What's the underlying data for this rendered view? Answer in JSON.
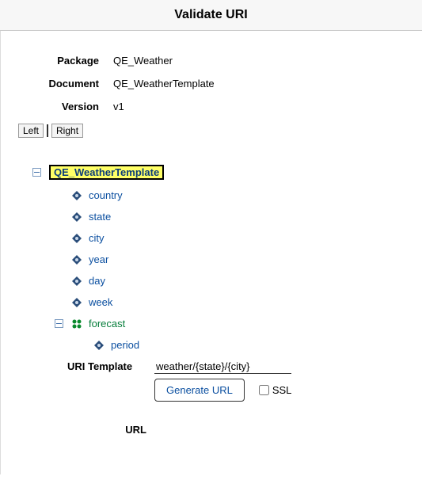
{
  "title": "Validate URI",
  "meta": {
    "package_label": "Package",
    "package_value": "QE_Weather",
    "document_label": "Document",
    "document_value": "QE_WeatherTemplate",
    "version_label": "Version",
    "version_value": "v1"
  },
  "tabs": {
    "left": "Left",
    "right": "Right"
  },
  "tree": {
    "root": "QE_WeatherTemplate",
    "children": {
      "country": "country",
      "state": "state",
      "city": "city",
      "year": "year",
      "day": "day",
      "week": "week",
      "forecast": "forecast",
      "period": "period"
    }
  },
  "uri": {
    "label": "URI Template",
    "value": "weather/{state}/{city}",
    "generate": "Generate URL",
    "ssl": "SSL"
  },
  "url_label": "URL"
}
